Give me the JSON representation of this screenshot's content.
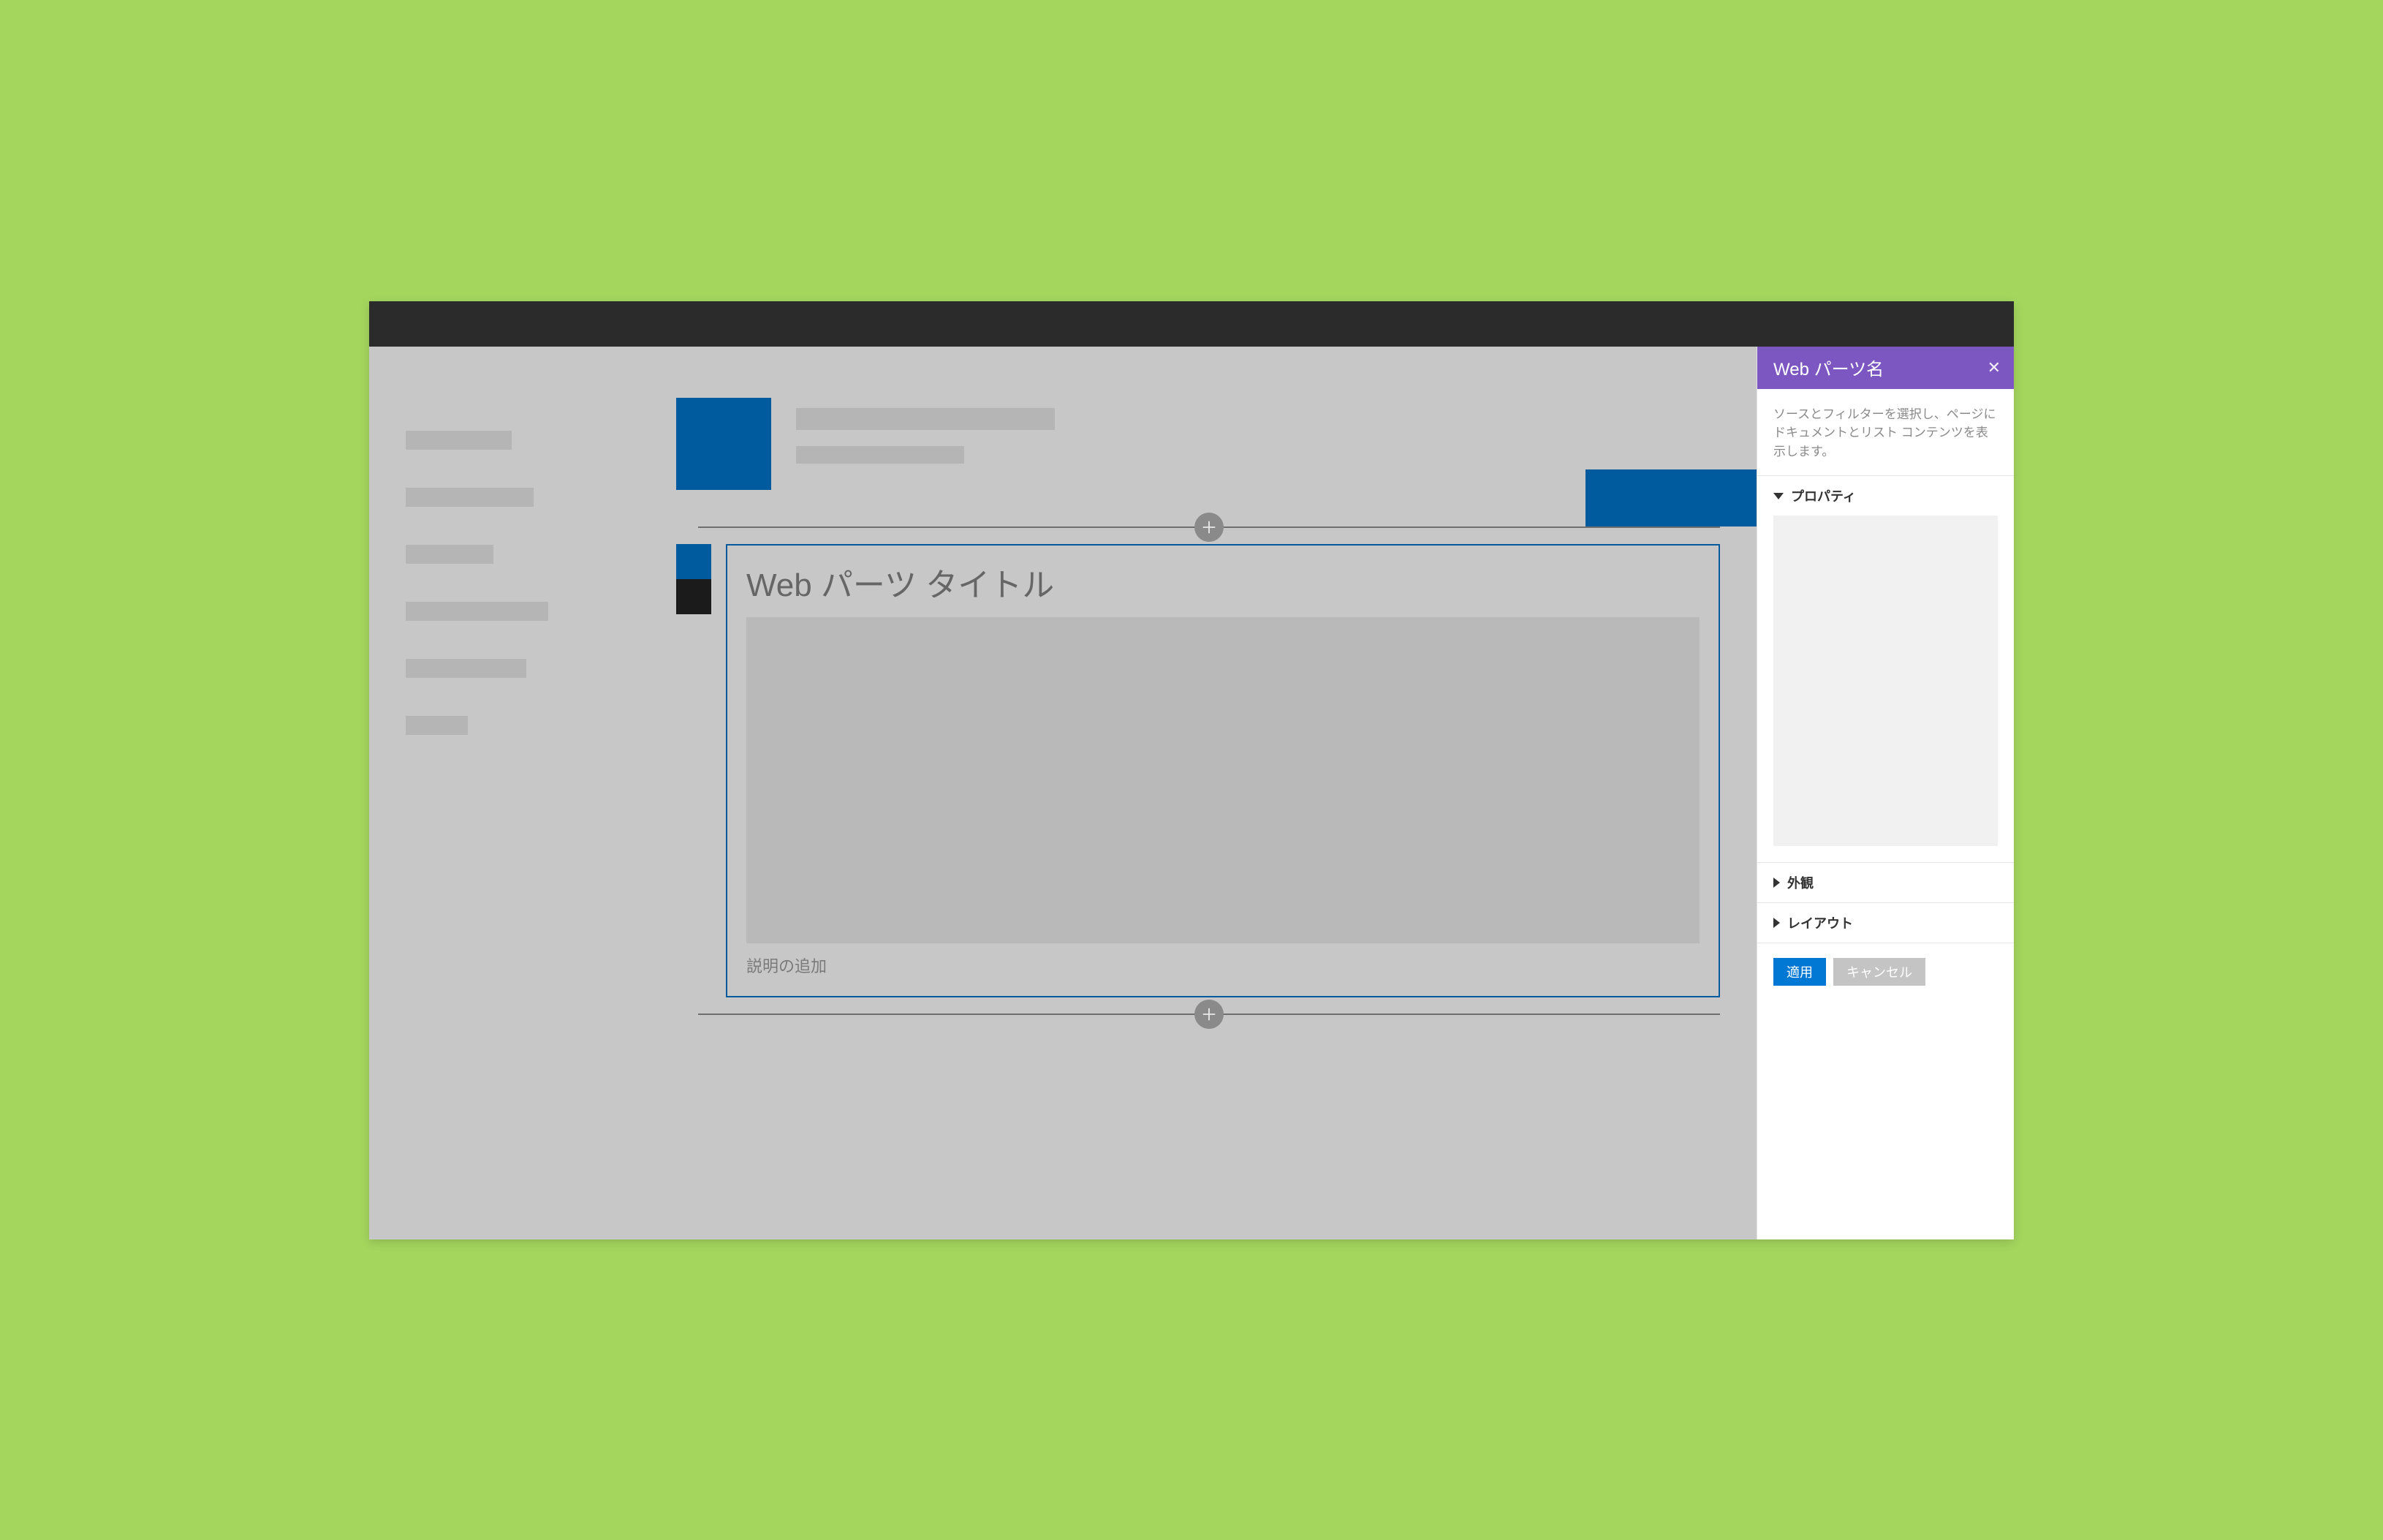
{
  "webpart": {
    "title": "Web パーツ タイトル",
    "description_placeholder": "説明の追加"
  },
  "pane": {
    "title": "Web パーツ名",
    "description": "ソースとフィルターを選択し、ページにドキュメントとリスト コンテンツを表示します。",
    "sections": {
      "properties": "プロパティ",
      "appearance": "外観",
      "layout": "レイアウト"
    },
    "actions": {
      "apply": "適用",
      "cancel": "キャンセル"
    }
  }
}
